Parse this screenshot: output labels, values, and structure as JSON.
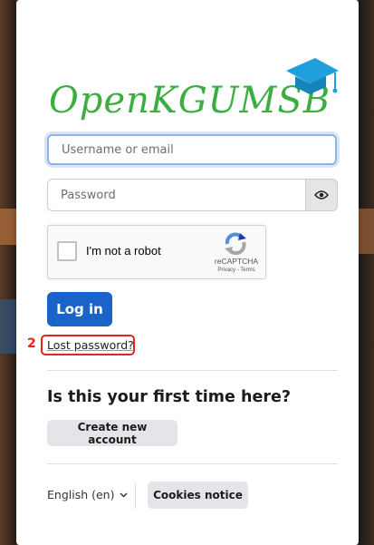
{
  "brand": {
    "logo_text": "OpenKGUMSB",
    "logo_color": "#3cae3f",
    "cap_color": "#1fa0dc"
  },
  "form": {
    "username_placeholder": "Username or email",
    "password_placeholder": "Password",
    "show_password_icon": "eye-icon",
    "recaptcha": {
      "label": "I'm not a robot",
      "brand": "reCAPTCHA",
      "terms": "Privacy - Terms"
    },
    "login_label": "Log in",
    "lost_password_label": "Lost password?"
  },
  "annotation": {
    "number": "2",
    "color": "#e0261d"
  },
  "signup": {
    "heading": "Is this your first time here?",
    "create_label": "Create new account"
  },
  "footer": {
    "language": "English (en)",
    "language_icon": "chevron-down-icon",
    "cookies_label": "Cookies notice"
  },
  "colors": {
    "primary": "#1a63c9",
    "secondary_btn": "#e3e5e8"
  }
}
